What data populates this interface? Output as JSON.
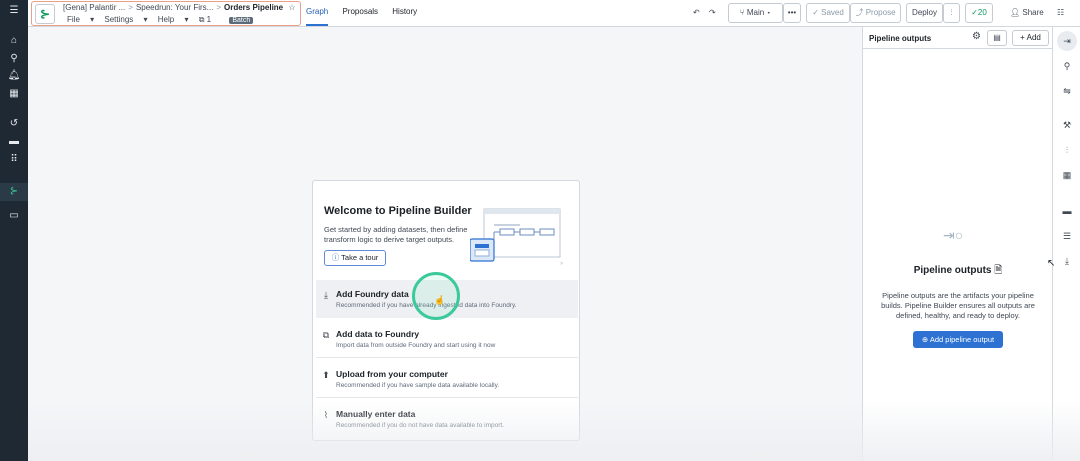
{
  "breadcrumbs": [
    "[Gena] Palantir ...",
    "Speedrun: Your Firs...",
    "Orders Pipeline"
  ],
  "menus": [
    "File",
    "Settings",
    "Help"
  ],
  "meta": {
    "count": "1",
    "mode": "Batch"
  },
  "tabs": [
    "Graph",
    "Proposals",
    "History"
  ],
  "toolbar": {
    "branch": "Main",
    "saved": "Saved",
    "propose": "Propose",
    "deploy": "Deploy",
    "checks": "20",
    "share": "Share"
  },
  "welcome": {
    "title": "Welcome to Pipeline Builder",
    "description": "Get started by adding datasets, then define transform logic to derive target outputs.",
    "tour": "Take a tour",
    "options": [
      {
        "title": "Add Foundry data",
        "desc": "Recommended if you have already ingested data into Foundry."
      },
      {
        "title": "Add data to Foundry",
        "desc": "Import data from outside Foundry and start using it now"
      },
      {
        "title": "Upload from your computer",
        "desc": "Recommended if you have sample data available locally."
      },
      {
        "title": "Manually enter data",
        "desc": "Recommended if you do not have data available to import."
      }
    ]
  },
  "outputs_panel": {
    "title": "Pipeline outputs",
    "add": "Add",
    "empty_title": "Pipeline outputs",
    "empty_desc": "Pipeline outputs are the artifacts your pipeline builds. Pipeline Builder ensures all outputs are defined, healthy, and ready to deploy.",
    "cta": "Add pipeline output"
  },
  "colors": {
    "accent": "#2d72d2",
    "success": "#0f9960",
    "highlight_ring": "#3bc99a"
  }
}
